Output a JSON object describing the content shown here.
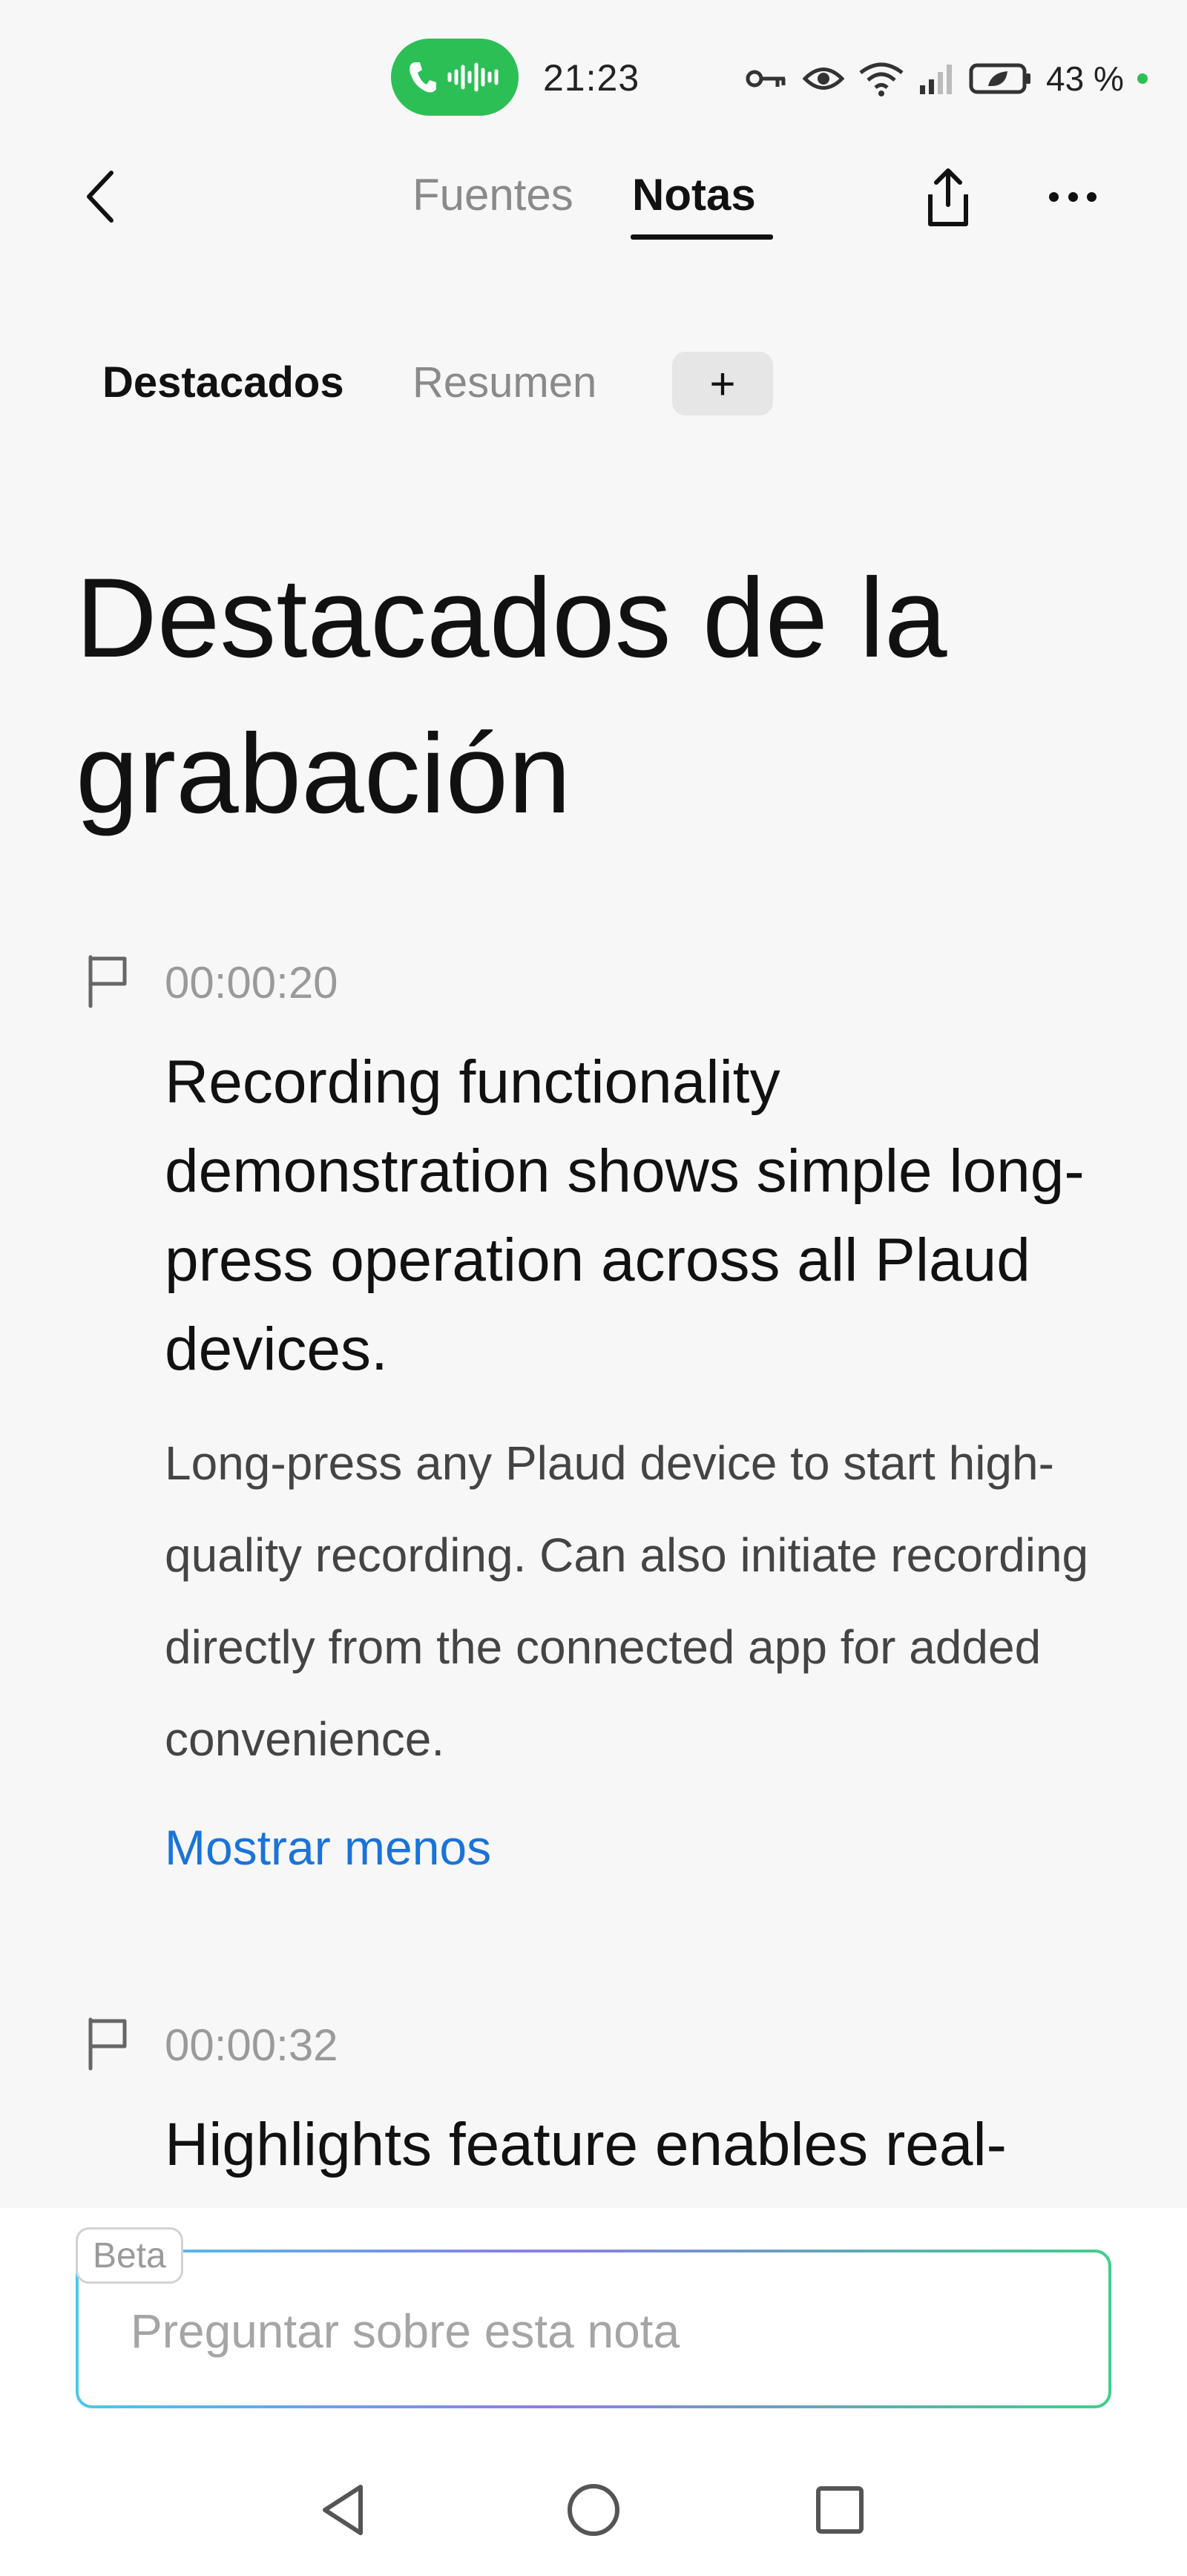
{
  "status_bar": {
    "time": "21:23",
    "battery": "43 %",
    "icons": [
      "phone-call-icon",
      "audio-wave-icon",
      "key-icon",
      "eye-icon",
      "wifi-icon",
      "signal-icon",
      "battery-saver-icon"
    ],
    "call_color": "#2cbf55"
  },
  "header": {
    "tabs": [
      {
        "label": "Fuentes",
        "active": false
      },
      {
        "label": "Notas",
        "active": true
      }
    ],
    "icons": [
      "back-icon",
      "share-icon",
      "more-icon"
    ]
  },
  "subtabs": {
    "items": [
      {
        "label": "Destacados",
        "active": true
      },
      {
        "label": "Resumen",
        "active": false
      }
    ],
    "add_label": "+"
  },
  "page": {
    "title": "Destacados de la grabación"
  },
  "highlights": [
    {
      "time": "00:00:20",
      "title": "Recording functionality demonstration shows simple long-press operation across all Plaud devices.",
      "body": "Long-press any Plaud device to start high-quality recording. Can also initiate recording directly from the connected app for added convenience.",
      "toggle": "Mostrar menos"
    },
    {
      "time": "00:00:32",
      "title": "Highlights feature enables real-"
    }
  ],
  "ask": {
    "badge": "Beta",
    "placeholder": "Preguntar sobre esta nota"
  },
  "nav": {
    "icons": [
      "nav-back-icon",
      "nav-home-icon",
      "nav-recents-icon"
    ]
  },
  "colors": {
    "accent_link": "#1a73d9",
    "background": "#f7f7f7"
  }
}
